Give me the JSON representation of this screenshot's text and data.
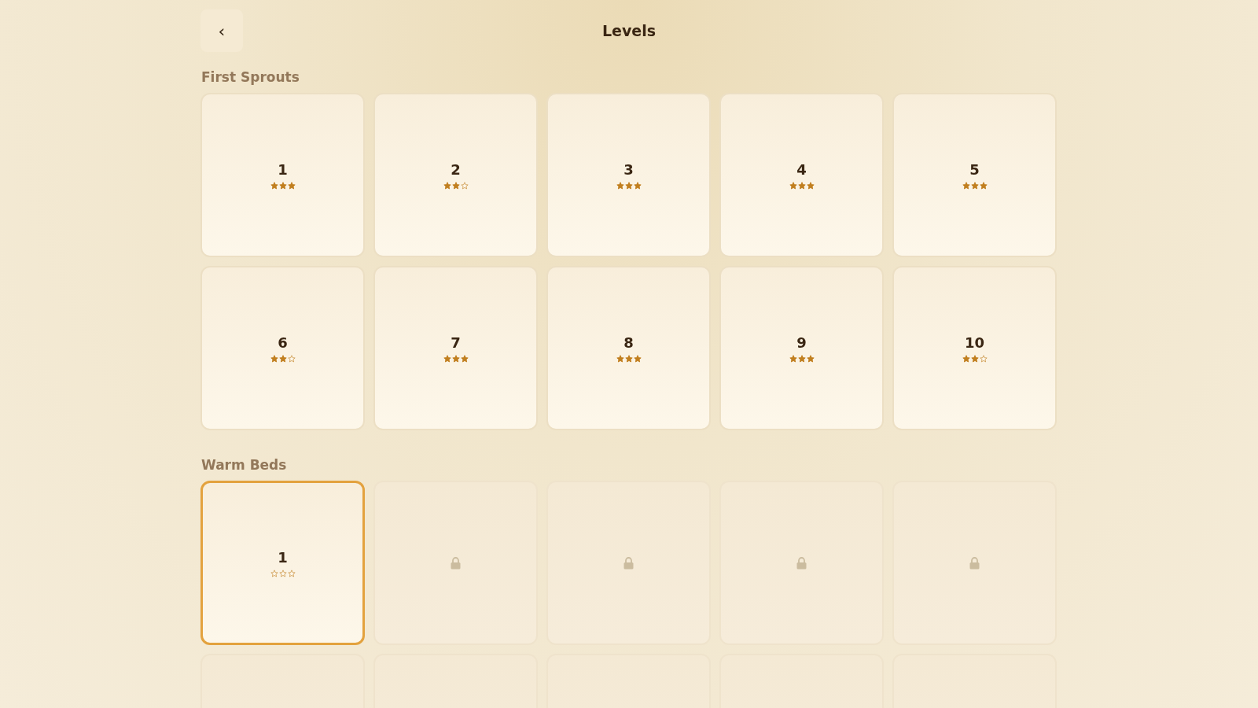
{
  "header": {
    "back": "‹",
    "title": "Levels"
  },
  "sections": [
    {
      "title": "First Sprouts",
      "cards": [
        {
          "kind": "level",
          "number": "1",
          "stars": 3,
          "selected": false
        },
        {
          "kind": "level",
          "number": "2",
          "stars": 2,
          "selected": false
        },
        {
          "kind": "level",
          "number": "3",
          "stars": 3,
          "selected": false
        },
        {
          "kind": "level",
          "number": "4",
          "stars": 3,
          "selected": false
        },
        {
          "kind": "level",
          "number": "5",
          "stars": 3,
          "selected": false
        },
        {
          "kind": "level",
          "number": "6",
          "stars": 2,
          "selected": false
        },
        {
          "kind": "level",
          "number": "7",
          "stars": 3,
          "selected": false
        },
        {
          "kind": "level",
          "number": "8",
          "stars": 3,
          "selected": false
        },
        {
          "kind": "level",
          "number": "9",
          "stars": 3,
          "selected": false
        },
        {
          "kind": "level",
          "number": "10",
          "stars": 2,
          "selected": false
        }
      ]
    },
    {
      "title": "Warm Beds",
      "cards": [
        {
          "kind": "level",
          "number": "1",
          "stars": 0,
          "selected": true
        },
        {
          "kind": "locked"
        },
        {
          "kind": "locked"
        },
        {
          "kind": "locked"
        },
        {
          "kind": "locked"
        },
        {
          "kind": "blank"
        },
        {
          "kind": "blank"
        },
        {
          "kind": "blank"
        },
        {
          "kind": "blank"
        },
        {
          "kind": "blank"
        }
      ]
    }
  ]
}
